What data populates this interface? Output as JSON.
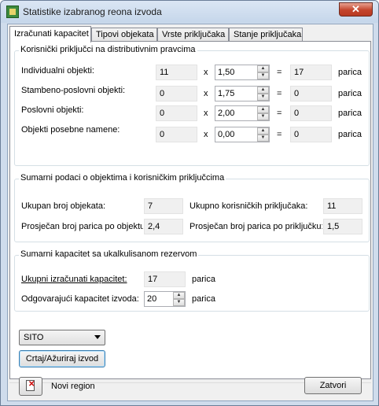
{
  "window": {
    "title": "Statistike izabranog reona izvoda",
    "close": "✕"
  },
  "tabs": [
    "Izračunati kapacitet",
    "Tipovi objekata",
    "Vrste priključaka",
    "Stanje priključaka"
  ],
  "group1": {
    "title": "Korisnički priključci na distributivnim pravcima",
    "rows": [
      {
        "label": "Individualni objekti:",
        "count": "11",
        "factor": "1,50",
        "result": "17",
        "unit": "parica"
      },
      {
        "label": "Stambeno-poslovni objekti:",
        "count": "0",
        "factor": "1,75",
        "result": "0",
        "unit": "parica"
      },
      {
        "label": "Poslovni objekti:",
        "count": "0",
        "factor": "2,00",
        "result": "0",
        "unit": "parica"
      },
      {
        "label": "Objekti posebne namene:",
        "count": "0",
        "factor": "0,00",
        "result": "0",
        "unit": "parica"
      }
    ],
    "times": "x",
    "equals": "="
  },
  "group2": {
    "title": "Sumarni podaci o objektima i korisničkim priključcima",
    "ukupan_label": "Ukupan broj objekata:",
    "ukupan_value": "7",
    "korisnickih_label": "Ukupno korisničkih priključaka:",
    "korisnickih_value": "11",
    "prosjek_obj_label": "Prosječan broj parica po objektu:",
    "prosjek_obj_value": "2,4",
    "prosjek_prik_label": "Prosječan broj parica po priključku:",
    "prosjek_prik_value": "1,5"
  },
  "group3": {
    "title": "Sumarni kapacitet sa ukalkulisanom rezervom",
    "ukupni_label": "Ukupni izračunati kapacitet:",
    "ukupni_value": "17",
    "ukupni_unit": "parica",
    "odg_label": "Odgovarajući kapacitet izvoda:",
    "odg_value": "20",
    "odg_unit": "parica"
  },
  "combo": {
    "selected": "SITO"
  },
  "buttons": {
    "refresh": "Crtaj/Ažuriraj izvod",
    "close": "Zatvori"
  },
  "bottom": {
    "new_region": "Novi region"
  }
}
